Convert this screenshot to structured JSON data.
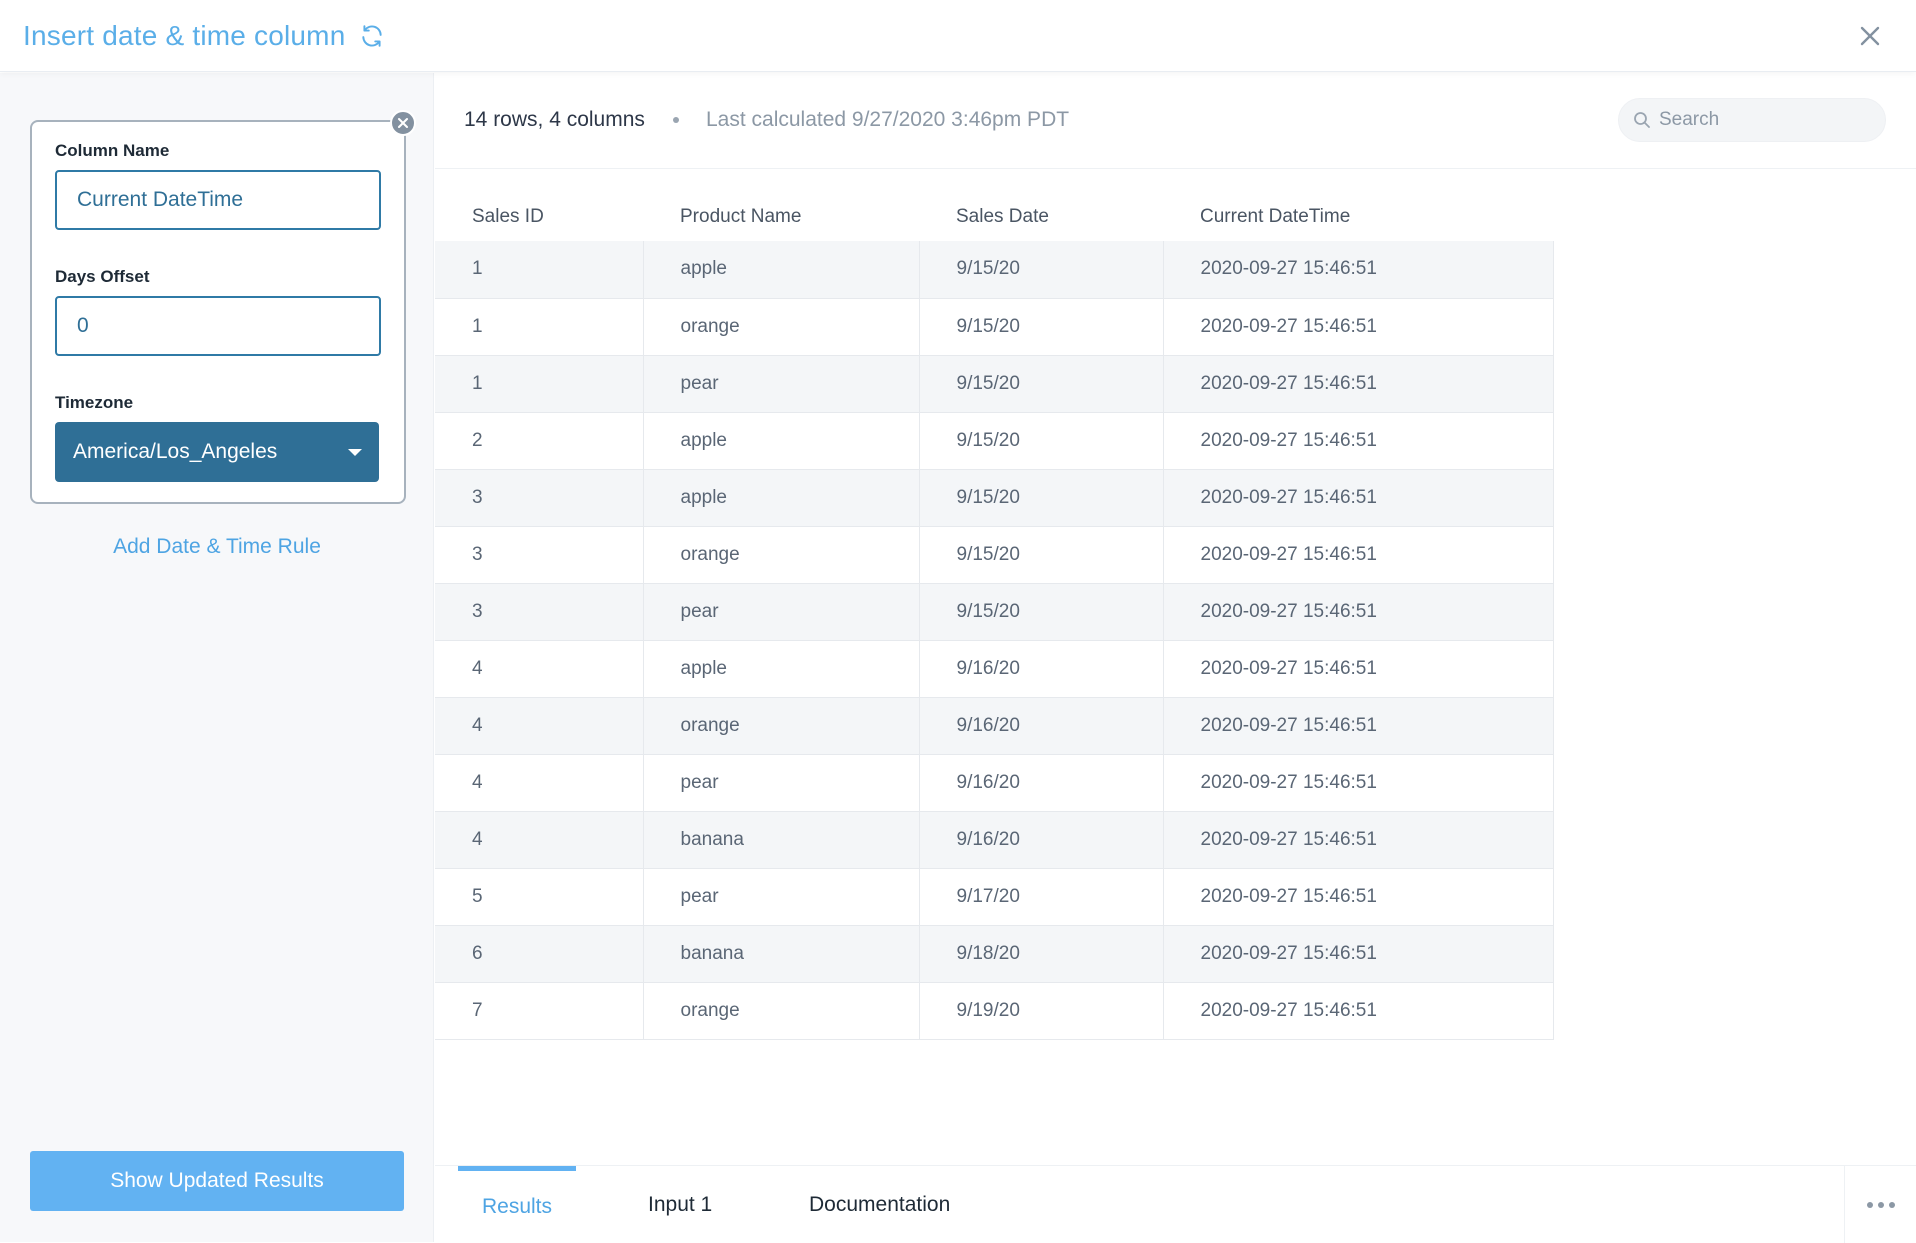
{
  "header": {
    "title": "Insert date & time column",
    "refresh_icon": "refresh-icon",
    "close_icon": "close-icon"
  },
  "sidebar": {
    "rule": {
      "column_name_label": "Column Name",
      "column_name_value": "Current DateTime",
      "days_offset_label": "Days Offset",
      "days_offset_value": "0",
      "timezone_label": "Timezone",
      "timezone_value": "America/Los_Angeles"
    },
    "add_rule_label": "Add Date & Time Rule",
    "show_results_label": "Show Updated Results"
  },
  "main": {
    "row_count": "14 rows, 4 columns",
    "last_calculated": "Last calculated 9/27/2020 3:46pm PDT",
    "search_placeholder": "Search",
    "table": {
      "columns": [
        "Sales ID",
        "Product Name",
        "Sales Date",
        "Current DateTime"
      ],
      "rows": [
        [
          "1",
          "apple",
          "9/15/20",
          "2020-09-27 15:46:51"
        ],
        [
          "1",
          "orange",
          "9/15/20",
          "2020-09-27 15:46:51"
        ],
        [
          "1",
          "pear",
          "9/15/20",
          "2020-09-27 15:46:51"
        ],
        [
          "2",
          "apple",
          "9/15/20",
          "2020-09-27 15:46:51"
        ],
        [
          "3",
          "apple",
          "9/15/20",
          "2020-09-27 15:46:51"
        ],
        [
          "3",
          "orange",
          "9/15/20",
          "2020-09-27 15:46:51"
        ],
        [
          "3",
          "pear",
          "9/15/20",
          "2020-09-27 15:46:51"
        ],
        [
          "4",
          "apple",
          "9/16/20",
          "2020-09-27 15:46:51"
        ],
        [
          "4",
          "orange",
          "9/16/20",
          "2020-09-27 15:46:51"
        ],
        [
          "4",
          "pear",
          "9/16/20",
          "2020-09-27 15:46:51"
        ],
        [
          "4",
          "banana",
          "9/16/20",
          "2020-09-27 15:46:51"
        ],
        [
          "5",
          "pear",
          "9/17/20",
          "2020-09-27 15:46:51"
        ],
        [
          "6",
          "banana",
          "9/18/20",
          "2020-09-27 15:46:51"
        ],
        [
          "7",
          "orange",
          "9/19/20",
          "2020-09-27 15:46:51"
        ]
      ]
    },
    "tabs": [
      {
        "label": "Results",
        "active": true
      },
      {
        "label": "Input 1",
        "active": false
      },
      {
        "label": "Documentation",
        "active": false
      }
    ],
    "more_icon": "more-horizontal-icon"
  },
  "colors": {
    "accent": "#5aaee8",
    "select_bg": "#2f6f96",
    "button_bg": "#62b2f2"
  }
}
